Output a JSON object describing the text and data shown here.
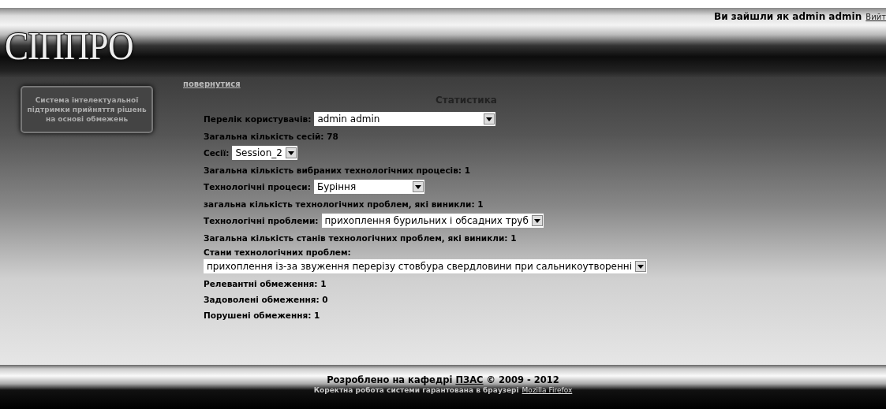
{
  "header": {
    "logo": "СІППРО",
    "user_text": "Ви зайшли як admin admin",
    "logout_link": "Вийт"
  },
  "sidebar": {
    "text": "Система інтелектуальної підтримки прийняття рішень на основі обмежень"
  },
  "back_link": "повернутися",
  "title": "Статистика",
  "rows": [
    {
      "kind": "select",
      "label": "Перелік користувачів:",
      "value": "admin admin"
    },
    {
      "kind": "text",
      "text": "Загальна кількість сесій: 78"
    },
    {
      "kind": "select",
      "label": "Сесії:",
      "value": "Session_2"
    },
    {
      "kind": "text",
      "text": "Загальна кількість вибраних технологічних процесів: 1"
    },
    {
      "kind": "select",
      "label": "Технологічні процеси:",
      "value": "Буріння"
    },
    {
      "kind": "text",
      "text": "загальна кількість технологічних проблем, які виникли: 1"
    },
    {
      "kind": "select",
      "label": "Технологічні проблеми:",
      "value": "прихоплення бурильних і обсадних труб"
    },
    {
      "kind": "text",
      "text": "Загальна кількість станів технологічних проблем, які виникли: 1"
    },
    {
      "kind": "select_below",
      "label": "Стани технологічних проблем:",
      "value": "прихоплення із-за звуження перерізу стовбура свердловини при сальникоутворенні"
    },
    {
      "kind": "text",
      "text": "Релевантні обмеження: 1"
    },
    {
      "kind": "text",
      "text": "Задоволені обмеження: 0"
    },
    {
      "kind": "text",
      "text": "Порушені обмеження: 1"
    }
  ],
  "footer": {
    "credit": "Розроблено на кафедрі",
    "credit_link": "ПЗАС",
    "years": "© 2009 - 2012",
    "note": "Коректна робота системи гарантована в браузері",
    "browser_link": "Mozilla Firefox"
  }
}
